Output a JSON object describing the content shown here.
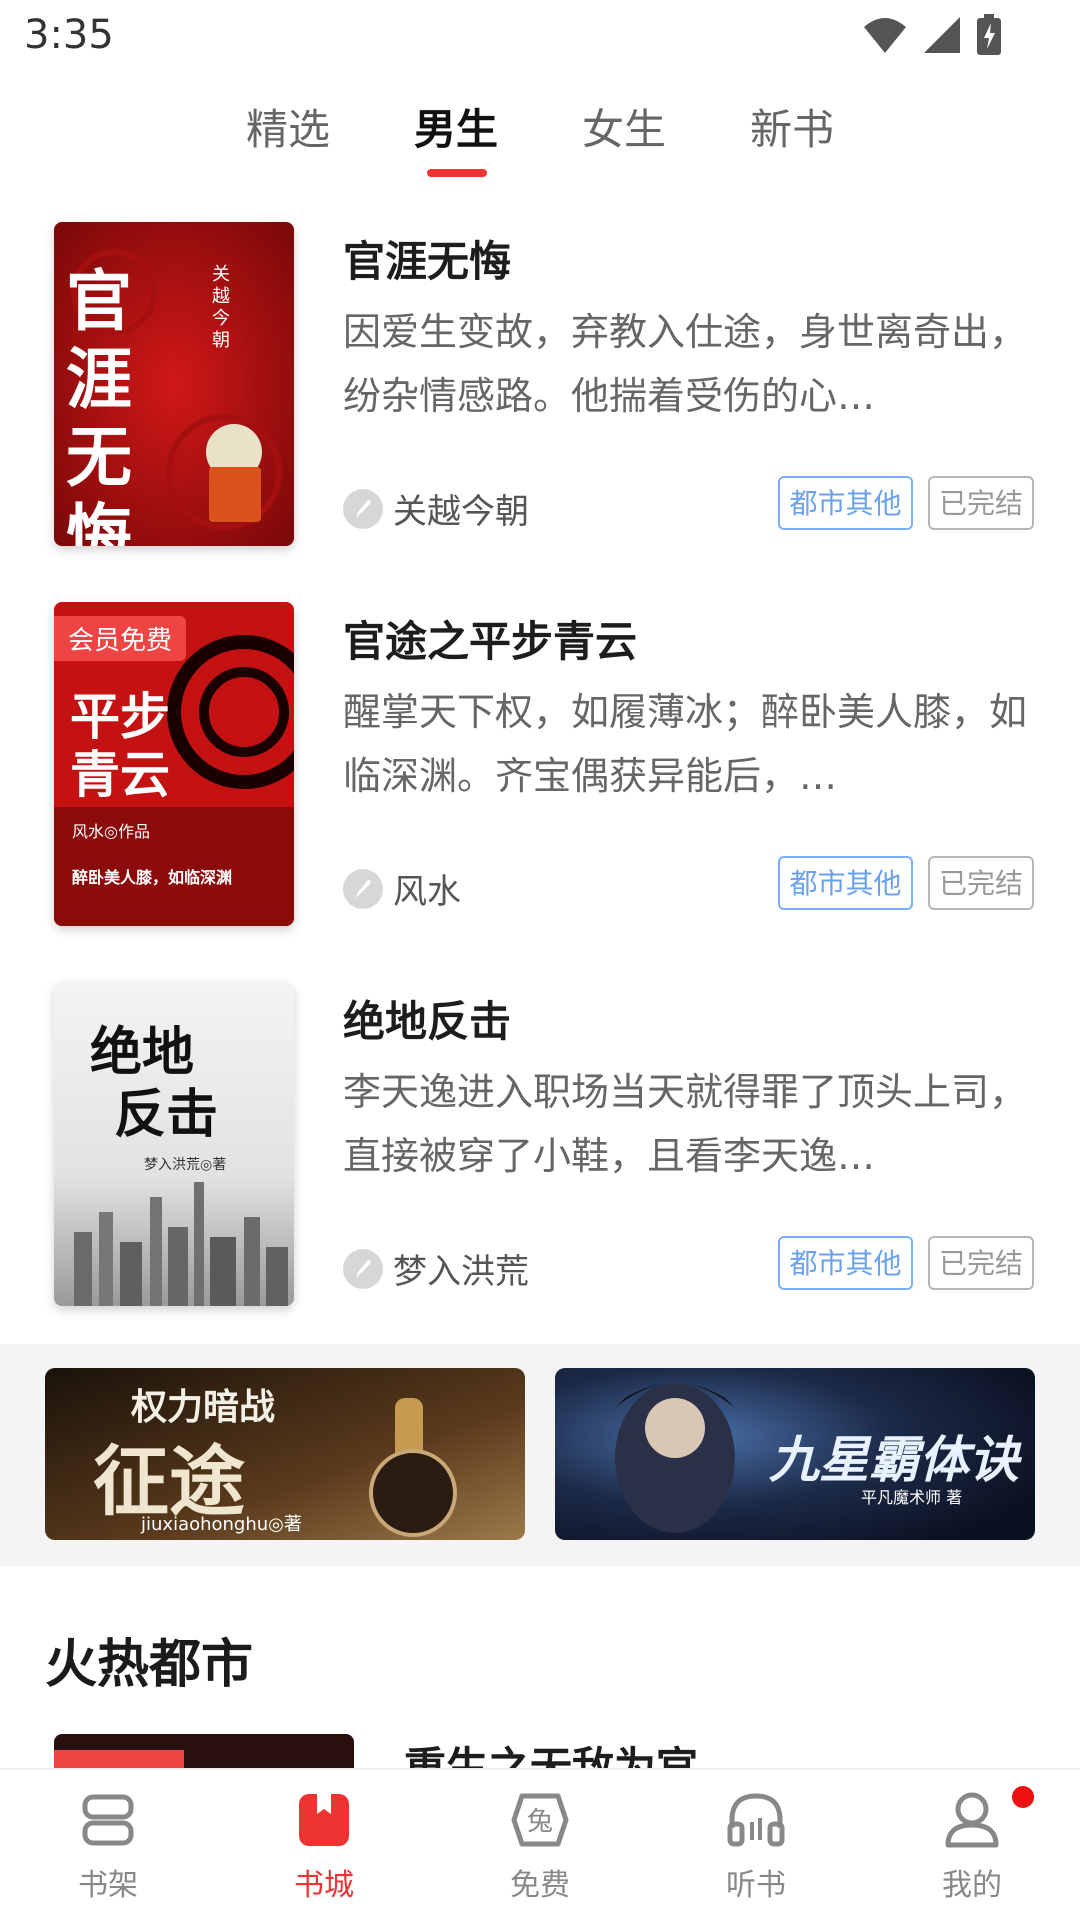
{
  "status_bar": {
    "time": "3:35"
  },
  "top_tabs": [
    {
      "label": "精选",
      "active": false
    },
    {
      "label": "男生",
      "active": true
    },
    {
      "label": "女生",
      "active": false
    },
    {
      "label": "新书",
      "active": false
    }
  ],
  "books": [
    {
      "title": "官涯无悔",
      "description": "因爱生变故，弃教入仕途，身世离奇出，纷杂情感路。他揣着受伤的心…",
      "author": "关越今朝",
      "genre_tag": "都市其他",
      "status_tag": "已完结",
      "cover_title": "官涯无悔",
      "cover_author": "关越今朝"
    },
    {
      "title": "官途之平步青云",
      "description": "醒掌天下权，如履薄冰；醉卧美人膝，如临深渊。齐宝偶获异能后，…",
      "author": "风水",
      "genre_tag": "都市其他",
      "status_tag": "已完结",
      "badge": "会员免费",
      "cover_title_1": "平步",
      "cover_title_2": "青云",
      "cover_line_1": "风水◎作品",
      "cover_line_2": "醉卧美人膝，如临深渊"
    },
    {
      "title": "绝地反击",
      "description": "李天逸进入职场当天就得罪了顶头上司，直接被穿了小鞋，且看李天逸…",
      "author": "梦入洪荒",
      "genre_tag": "都市其他",
      "status_tag": "已完结",
      "cover_title_1": "绝地",
      "cover_title_2": "反击",
      "cover_author": "梦入洪荒◎著"
    }
  ],
  "banners": [
    {
      "title": "权力暗战",
      "big_title": "征途",
      "author": "jiuxiaohonghu◎著"
    },
    {
      "title": "九星霸体诀",
      "author": "平凡魔术师 著"
    }
  ],
  "section": {
    "title": "火热都市",
    "next_book_title": "重生之无敌为官"
  },
  "bottom_nav": [
    {
      "label": "书架",
      "icon": "bookshelf-icon",
      "active": false
    },
    {
      "label": "书城",
      "icon": "bookstore-icon",
      "active": true
    },
    {
      "label": "免费",
      "icon": "free-icon",
      "active": false
    },
    {
      "label": "听书",
      "icon": "headphones-icon",
      "active": false
    },
    {
      "label": "我的",
      "icon": "profile-icon",
      "active": false
    }
  ],
  "colors": {
    "accent": "#ee3333",
    "genre_tag": "#6aa2ee",
    "status_tag": "#999999"
  }
}
